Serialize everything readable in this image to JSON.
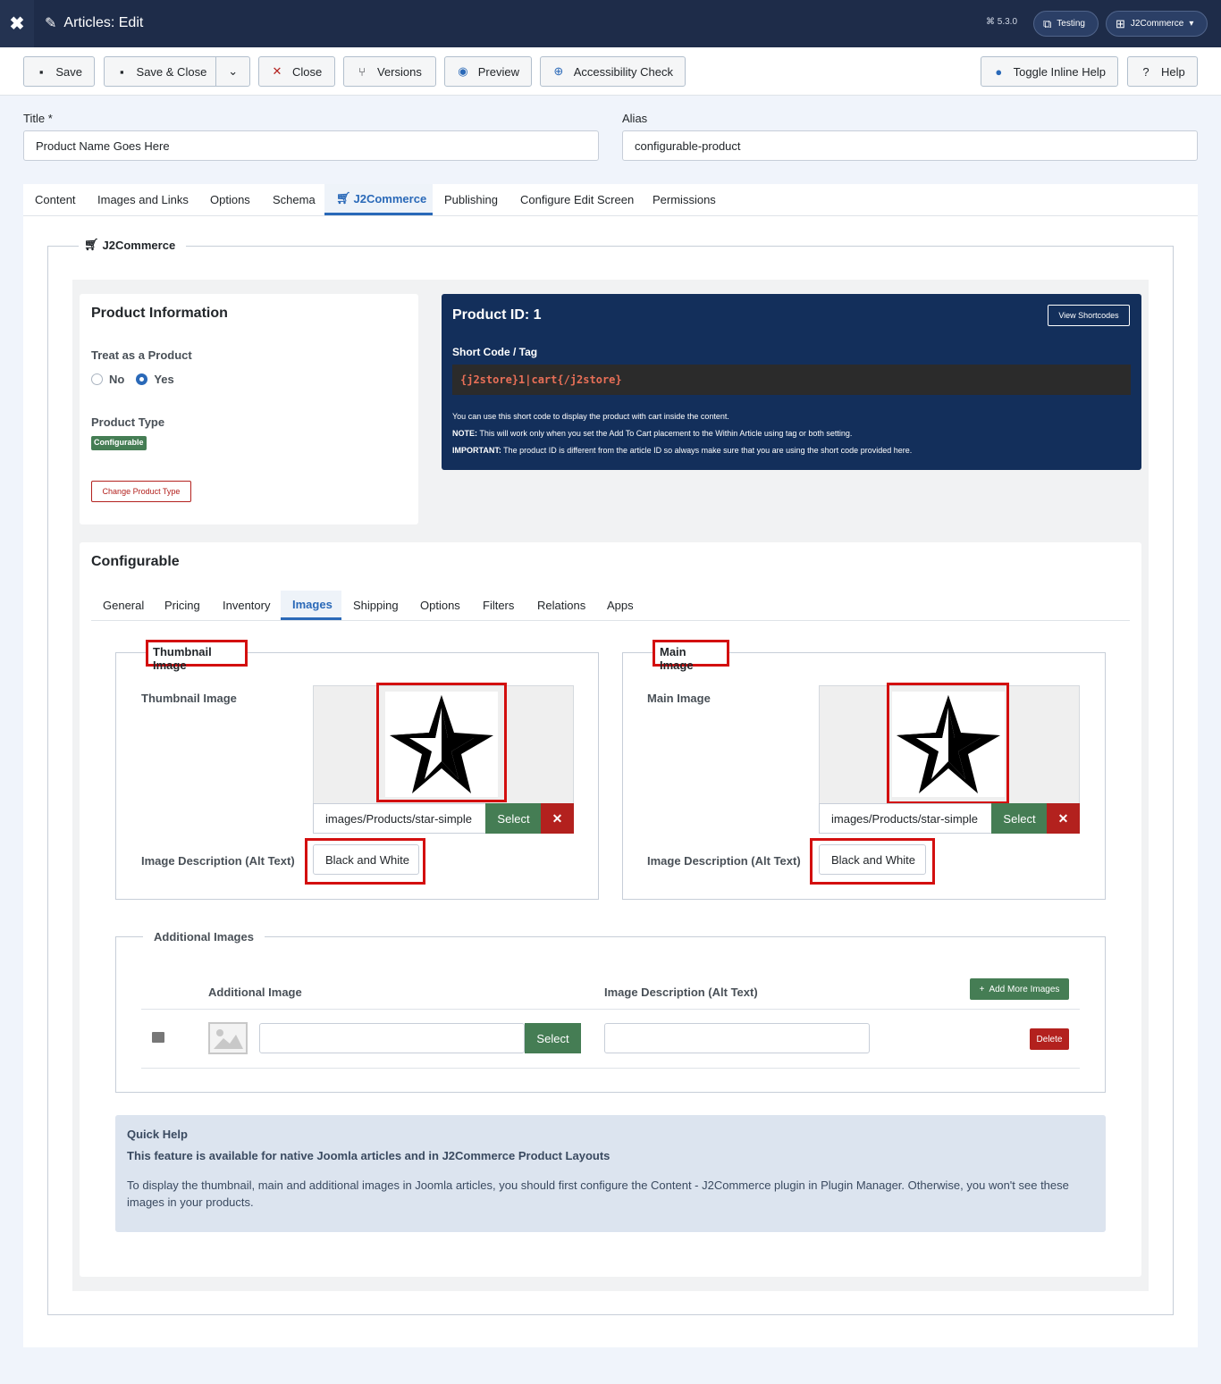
{
  "header": {
    "title": "Articles: Edit",
    "version": "5.3.0",
    "site_button": "Testing",
    "user_menu": "J2Commerce"
  },
  "toolbar": {
    "save": "Save",
    "save_close": "Save & Close",
    "close": "Close",
    "versions": "Versions",
    "preview": "Preview",
    "accessibility": "Accessibility Check",
    "toggle_help": "Toggle Inline Help",
    "help": "Help"
  },
  "form": {
    "title_label": "Title *",
    "title_value": "Product Name Goes Here",
    "alias_label": "Alias",
    "alias_value": "configurable-product"
  },
  "tabs": [
    "Content",
    "Images and Links",
    "Options",
    "Schema",
    "J2Commerce",
    "Publishing",
    "Configure Edit Screen",
    "Permissions"
  ],
  "j2": {
    "legend": "J2Commerce",
    "product_info": {
      "heading": "Product Information",
      "treat_label": "Treat as a Product",
      "no": "No",
      "yes": "Yes",
      "type_label": "Product Type",
      "type_badge": "Configurable",
      "change_button": "Change Product Type"
    },
    "product_id": {
      "heading": "Product ID: 1",
      "view_shortcodes": "View Shortcodes",
      "shortcode_label": "Short Code / Tag",
      "shortcode": "{j2store}1|cart{/j2store}",
      "note1": "You can use this short code to display the product with cart inside the content.",
      "note2_label": "NOTE:",
      "note2": " This will work only when you set the Add To Cart placement to the Within Article using tag or both setting.",
      "note3_label": "IMPORTANT:",
      "note3": " The product ID is different from the article ID so always make sure that you are using the short code provided here."
    },
    "configurable": {
      "heading": "Configurable",
      "subtabs": [
        "General",
        "Pricing",
        "Inventory",
        "Images",
        "Shipping",
        "Options",
        "Filters",
        "Relations",
        "Apps"
      ],
      "thumb": {
        "legend": "Thumbnail Image",
        "label": "Thumbnail Image",
        "path": "images/Products/star-simple",
        "select": "Select",
        "alt_label": "Image Description (Alt Text)",
        "alt_value": "Black and White"
      },
      "main": {
        "legend": "Main Image",
        "label": "Main Image",
        "path": "images/Products/star-simple",
        "select": "Select",
        "alt_label": "Image Description (Alt Text)",
        "alt_value": "Black and White"
      },
      "additional": {
        "legend": "Additional Images",
        "col_image": "Additional Image",
        "col_desc": "Image Description (Alt Text)",
        "add_more": "Add More Images",
        "select": "Select",
        "delete": "Delete"
      },
      "quick_help": {
        "title": "Quick Help",
        "subtitle": "This feature is available for native Joomla articles and in J2Commerce Product Layouts",
        "text": "To display the thumbnail, main and additional images in Joomla articles, you should first configure the Content - J2Commerce plugin in Plugin Manager. Otherwise, you won't see these images in your products."
      }
    }
  },
  "colors": {
    "header": "#1e2c49",
    "accent": "#2a69b8",
    "green": "#457d54",
    "danger": "#b3211e",
    "highlight": "#d30f0f"
  },
  "icons": [
    "joomla-icon",
    "pencil-icon",
    "save-icon",
    "close-icon",
    "versions-icon",
    "eye-icon",
    "accessibility-icon",
    "question-icon",
    "cart-icon",
    "star-image",
    "image-icon",
    "plus-icon",
    "chevron-down-icon"
  ]
}
